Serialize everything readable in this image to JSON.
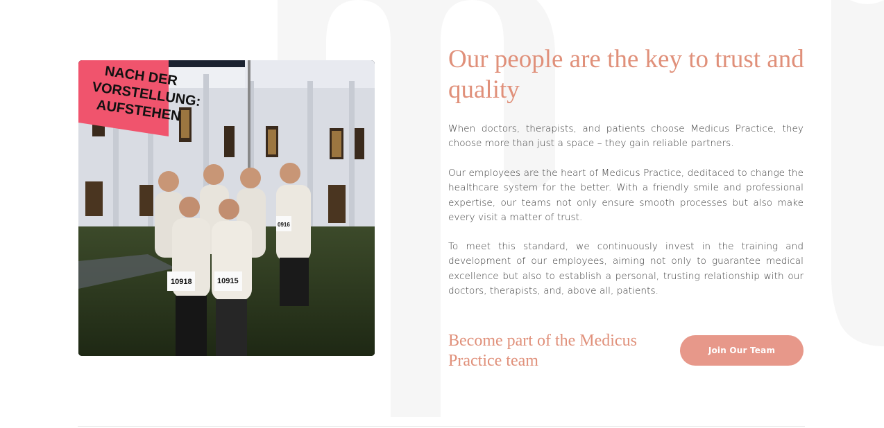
{
  "colors": {
    "accent": "#e0907a",
    "button_bg": "#e7988a",
    "button_text": "#ffffff",
    "body_text": "#3a3a3a",
    "watermark": "#f5f5f5"
  },
  "photo": {
    "banner_line1": "NACH DER",
    "banner_line2": "VORSTELLUNG:",
    "banner_line3": "AUFSTEHEN",
    "bib_left": "10918",
    "bib_center": "10915",
    "bib_right": "0916"
  },
  "content": {
    "heading": "Our people are the key to trust and quality",
    "paragraph1": "When doctors, therapists, and patients choose Medicus Practice, they choose more than just a space – they gain reliable partners.",
    "paragraph2": "Our employees are the heart of Medicus Practice, deditaced to change the healthcare system for the better. With a friendly smile and professional expertise, our teams not only ensure smooth processes but also make every visit a matter of trust.",
    "paragraph3": "To meet this standard, we continuously invest in the training and development of our employees, aiming not only to guarantee medical excellence but also to establish a personal, trusting relationship with our doctors, therapists, and, above all, patients.",
    "cta_text": "Become part of the Medicus Practice team",
    "cta_button": "Join Our Team"
  }
}
